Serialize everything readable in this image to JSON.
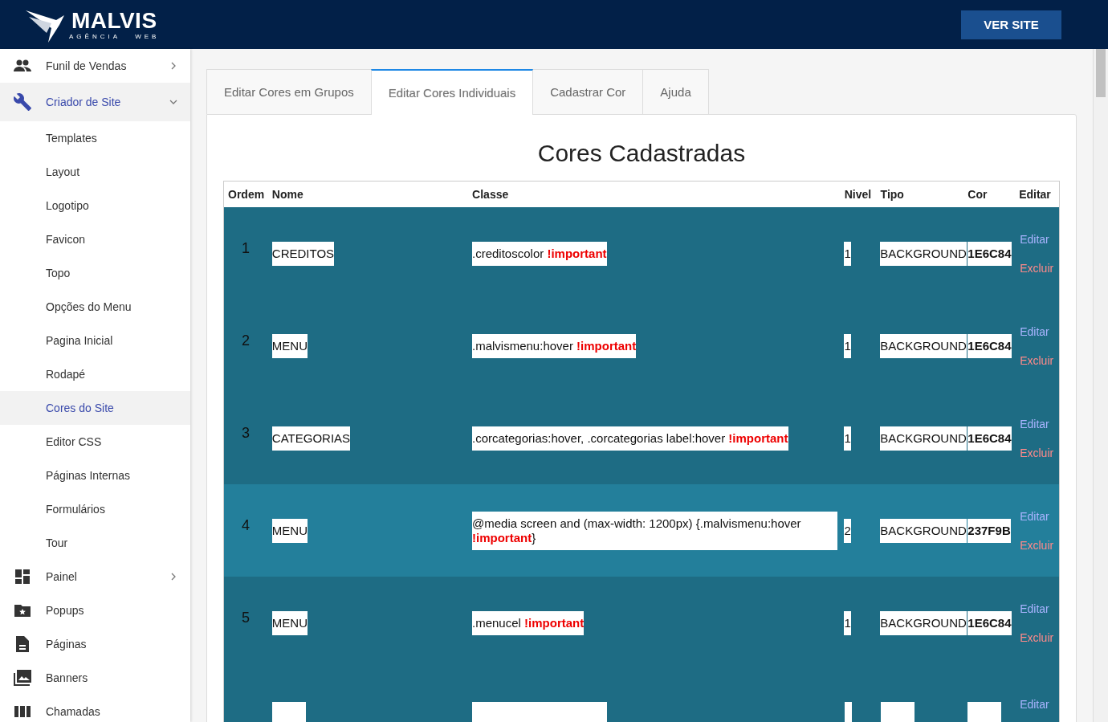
{
  "header": {
    "logo_title": "MALVIS",
    "logo_subtitle": "AGÊNCIA   WEB",
    "button": "VER SITE"
  },
  "sidebar": {
    "items": [
      {
        "label": "Funil de Vendas",
        "selected": false,
        "expanded": false
      },
      {
        "label": "Criador de Site",
        "selected": true,
        "expanded": true,
        "children": [
          {
            "label": "Templates",
            "selected": false
          },
          {
            "label": "Layout",
            "selected": false
          },
          {
            "label": "Logotipo",
            "selected": false
          },
          {
            "label": "Favicon",
            "selected": false
          },
          {
            "label": "Topo",
            "selected": false
          },
          {
            "label": "Opções do Menu",
            "selected": false
          },
          {
            "label": "Pagina Inicial",
            "selected": false
          },
          {
            "label": "Rodapé",
            "selected": false
          },
          {
            "label": "Cores do Site",
            "selected": true
          },
          {
            "label": "Editor CSS",
            "selected": false
          },
          {
            "label": "Páginas Internas",
            "selected": false
          },
          {
            "label": "Formulários",
            "selected": false
          },
          {
            "label": "Tour",
            "selected": false
          }
        ]
      },
      {
        "label": "Painel",
        "selected": false,
        "expanded": false
      },
      {
        "label": "Popups",
        "selected": false
      },
      {
        "label": "Páginas",
        "selected": false
      },
      {
        "label": "Banners",
        "selected": false
      },
      {
        "label": "Chamadas",
        "selected": false
      }
    ]
  },
  "tabs": [
    {
      "label": "Editar Cores em Grupos",
      "selected": false
    },
    {
      "label": "Editar Cores Individuais",
      "selected": true
    },
    {
      "label": "Cadastrar Cor",
      "selected": false
    },
    {
      "label": "Ajuda",
      "selected": false
    }
  ],
  "title": "Cores Cadastradas",
  "table": {
    "columns": [
      "Ordem",
      "Nome",
      "Classe",
      "Nivel",
      "Tipo",
      "Cor",
      "Editar"
    ],
    "rows": [
      {
        "order": "1",
        "name": "CREDITOS",
        "class": ".creditoscolor",
        "flag": "!important",
        "level": "1",
        "type": "BACKGROUND",
        "color_code": "1E6C84",
        "color": "#1e6c84",
        "edit": "Editar",
        "delete": "Excluir"
      },
      {
        "order": "2",
        "name": "MENU",
        "class": ".malvismenu:hover",
        "flag": "!important",
        "level": "1",
        "type": "BACKGROUND",
        "color_code": "1E6C84",
        "color": "#1e6c84",
        "edit": "Editar",
        "delete": "Excluir"
      },
      {
        "order": "3",
        "name": "CATEGORIAS",
        "class": ".corcategorias:hover, .corcategorias label:hover",
        "flag": "!important",
        "level": "1",
        "type": "BACKGROUND",
        "color_code": "1E6C84",
        "color": "#1e6c84",
        "edit": "Editar",
        "delete": "Excluir"
      },
      {
        "order": "4",
        "name": "MENU",
        "class": "@media screen and (max-width: 1200px) {.malvismenu:hover",
        "flag": "!important",
        "flag_suffix": "}",
        "level": "2",
        "type": "BACKGROUND",
        "color_code": "237F9B",
        "color": "#237f9b",
        "edit": "Editar",
        "delete": "Excluir"
      },
      {
        "order": "5",
        "name": "MENU",
        "class": ".menucel",
        "flag": "!important",
        "level": "1",
        "type": "BACKGROUND",
        "color_code": "1E6C84",
        "color": "#1e6c84",
        "edit": "Editar",
        "delete": "Excluir"
      },
      {
        "color": "#1e6c84",
        "edit": "Editar"
      }
    ]
  }
}
